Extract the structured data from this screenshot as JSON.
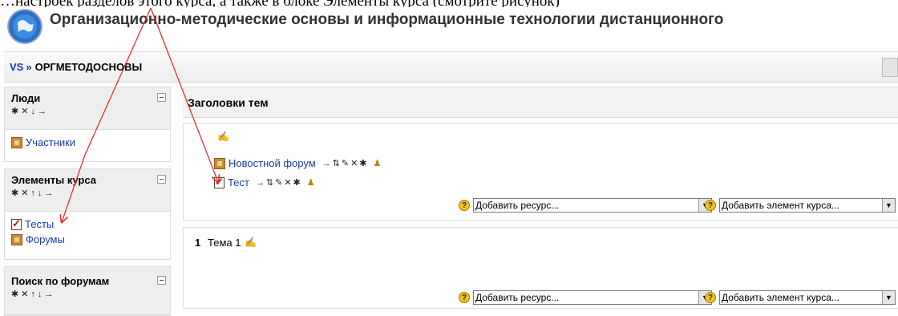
{
  "page_top_text": "…настроек разделов этого курса, а также в блоке Элементы курса (смотрите рисунок)",
  "site": {
    "title": "Организационно-методические основы и информационные технологии дистанционного"
  },
  "navbar": {
    "home": "VS",
    "separator": "»",
    "course": "ОРГМЕТОДОСНОВЫ"
  },
  "blocks": [
    {
      "title": "Люди",
      "controls": "✱✕↓→",
      "links": [
        {
          "label": "Участники",
          "icon": "people-icon"
        }
      ]
    },
    {
      "title": "Элементы курса",
      "controls": "✱✕↑↓→",
      "links": [
        {
          "label": "Тесты",
          "icon": "quiz-icon"
        },
        {
          "label": "Форумы",
          "icon": "forum-icon"
        }
      ]
    },
    {
      "title": "Поиск по форумам",
      "controls": "✱✕↑↓→"
    }
  ],
  "topics": {
    "header": "Заголовки тем",
    "section0": {
      "activities": [
        {
          "label": "Новостной форум",
          "icon": "forum-icon",
          "controls": "→⇅✎✕✱"
        },
        {
          "label": "Тест",
          "icon": "quiz-icon",
          "controls": "→⇅✎✕✱"
        }
      ]
    },
    "section1": {
      "number": "1",
      "name": "Тема 1"
    },
    "add_resource": "Добавить ресурс...",
    "add_activity": "Добавить элемент курса...",
    "help": "?"
  },
  "colors": {
    "link": "#1a3aa8",
    "annotation_arrow": "#e03030"
  }
}
